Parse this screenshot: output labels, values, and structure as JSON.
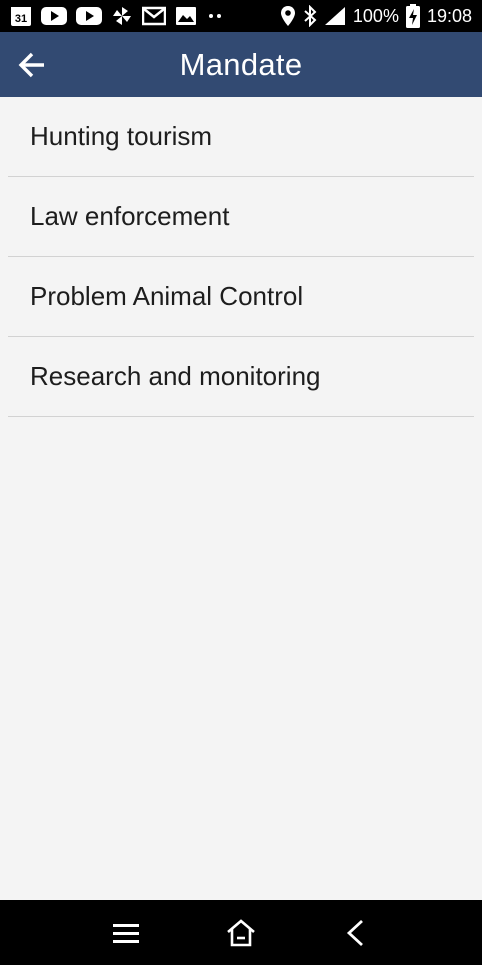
{
  "status_bar": {
    "left_icons": [
      "calendar-icon",
      "youtube-icon",
      "youtube-icon",
      "pinwheel-icon",
      "gmail-icon",
      "gallery-icon",
      "more-dots-icon"
    ],
    "calendar_day": "31",
    "battery_text": "100%",
    "time": "19:08"
  },
  "app_bar": {
    "title": "Mandate",
    "background": "#324a72"
  },
  "list": {
    "items": [
      {
        "label": "Hunting tourism"
      },
      {
        "label": "Law enforcement"
      },
      {
        "label": "Problem Animal Control"
      },
      {
        "label": "Research and monitoring"
      }
    ]
  },
  "nav_bar": {
    "buttons": [
      "menu-icon",
      "home-icon",
      "back-icon"
    ]
  }
}
